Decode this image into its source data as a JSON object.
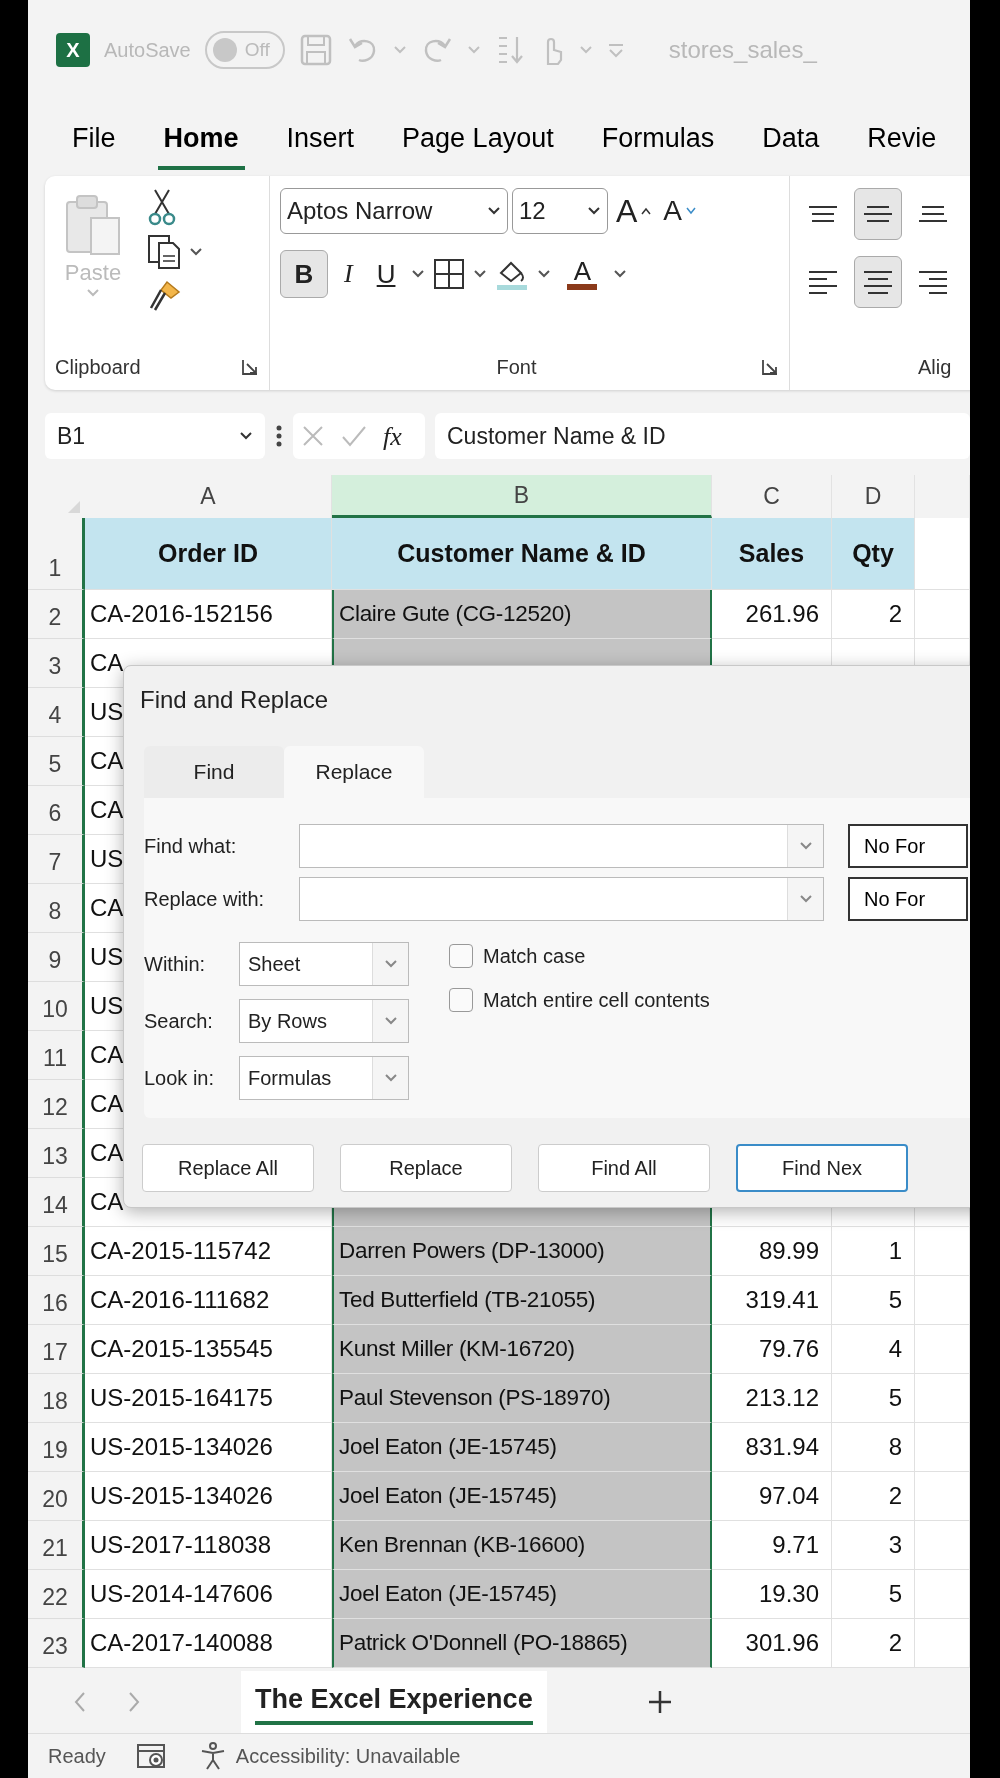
{
  "title_bar": {
    "logo_letter": "X",
    "autosave_label": "AutoSave",
    "autosave": {
      "on": false,
      "label": "Off"
    },
    "file_name": "stores_sales_"
  },
  "ribbon_tabs": [
    {
      "label": "File",
      "selected": false
    },
    {
      "label": "Home",
      "selected": true
    },
    {
      "label": "Insert",
      "selected": false
    },
    {
      "label": "Page Layout",
      "selected": false
    },
    {
      "label": "Formulas",
      "selected": false
    },
    {
      "label": "Data",
      "selected": false
    },
    {
      "label": "Revie",
      "selected": false
    }
  ],
  "clipboard": {
    "paste_label": "Paste",
    "group_label": "Clipboard"
  },
  "font": {
    "name": "Aptos Narrow",
    "size": "12",
    "grow_label": "A",
    "shrink_label": "A",
    "bold_label": "B",
    "italic_label": "I",
    "underline_label": "U",
    "font_color_label": "A",
    "bold": true,
    "group_label": "Font"
  },
  "alignment": {
    "group_label": "Alig",
    "vertical": [
      {
        "kind": "top",
        "selected": false
      },
      {
        "kind": "middle",
        "selected": true
      },
      {
        "kind": "bottom",
        "selected": false
      }
    ],
    "horizontal": [
      {
        "kind": "left",
        "selected": false
      },
      {
        "kind": "center",
        "selected": true
      },
      {
        "kind": "right",
        "selected": false
      }
    ]
  },
  "formula_bar": {
    "name_box": "B1",
    "fx_label": "fx",
    "content": "Customer Name & ID"
  },
  "columns": [
    {
      "label": "A",
      "selected": false
    },
    {
      "label": "B",
      "selected": true
    },
    {
      "label": "C",
      "selected": false
    },
    {
      "label": "D",
      "selected": false
    }
  ],
  "header_row": {
    "number": "1",
    "cells": [
      "Order ID",
      "Customer Name & ID",
      "Sales",
      "Qty"
    ]
  },
  "rows": [
    {
      "number": "2",
      "cells": [
        "CA-2016-152156",
        "Claire Gute (CG-12520)",
        "261.96",
        "2"
      ]
    },
    {
      "number": "3",
      "cells": [
        "CA"
      ]
    },
    {
      "number": "4",
      "cells": [
        "US"
      ]
    },
    {
      "number": "5",
      "cells": [
        "CA"
      ]
    },
    {
      "number": "6",
      "cells": [
        "CA"
      ]
    },
    {
      "number": "7",
      "cells": [
        "US"
      ]
    },
    {
      "number": "8",
      "cells": [
        "CA"
      ]
    },
    {
      "number": "9",
      "cells": [
        "US"
      ]
    },
    {
      "number": "10",
      "cells": [
        "US"
      ]
    },
    {
      "number": "11",
      "cells": [
        "CA"
      ]
    },
    {
      "number": "12",
      "cells": [
        "CA"
      ]
    },
    {
      "number": "13",
      "cells": [
        "CA"
      ]
    },
    {
      "number": "14",
      "cells": [
        "CA"
      ]
    },
    {
      "number": "15",
      "cells": [
        "CA-2015-115742",
        "Darren Powers (DP-13000)",
        "89.99",
        "1"
      ]
    },
    {
      "number": "16",
      "cells": [
        "CA-2016-111682",
        "Ted Butterfield (TB-21055)",
        "319.41",
        "5"
      ]
    },
    {
      "number": "17",
      "cells": [
        "CA-2015-135545",
        "Kunst Miller (KM-16720)",
        "79.76",
        "4"
      ]
    },
    {
      "number": "18",
      "cells": [
        "US-2015-164175",
        "Paul Stevenson (PS-18970)",
        "213.12",
        "5"
      ]
    },
    {
      "number": "19",
      "cells": [
        "US-2015-134026",
        "Joel Eaton (JE-15745)",
        "831.94",
        "8"
      ]
    },
    {
      "number": "20",
      "cells": [
        "US-2015-134026",
        "Joel Eaton (JE-15745)",
        "97.04",
        "2"
      ]
    },
    {
      "number": "21",
      "cells": [
        "US-2017-118038",
        "Ken Brennan (KB-16600)",
        "9.71",
        "3"
      ]
    },
    {
      "number": "22",
      "cells": [
        "US-2014-147606",
        "Joel Eaton (JE-15745)",
        "19.30",
        "5"
      ]
    },
    {
      "number": "23",
      "cells": [
        "CA-2017-140088",
        "Patrick O'Donnell (PO-18865)",
        "301.96",
        "2"
      ]
    }
  ],
  "dialog": {
    "title": "Find and Replace",
    "tabs": [
      {
        "label": "Find",
        "selected": false
      },
      {
        "label": "Replace",
        "selected": true
      }
    ],
    "fields": [
      {
        "label": "Find what:",
        "format_button": "No For"
      },
      {
        "label": "Replace with:",
        "format_button": "No For"
      }
    ],
    "options": [
      {
        "label": "Within:",
        "value": "Sheet"
      },
      {
        "label": "Search:",
        "value": "By Rows"
      },
      {
        "label": "Look in:",
        "value": "Formulas"
      }
    ],
    "checkboxes": [
      {
        "label": "Match case",
        "checked": false
      },
      {
        "label": "Match entire cell contents",
        "checked": false
      }
    ],
    "buttons": [
      {
        "label": "Replace All",
        "default": false
      },
      {
        "label": "Replace",
        "default": false
      },
      {
        "label": "Find All",
        "default": false
      },
      {
        "label": "Find Nex",
        "default": true
      }
    ]
  },
  "sheet_tabs": [
    {
      "label": "The Excel Experience",
      "selected": true
    }
  ],
  "status_bar": {
    "ready": "Ready",
    "accessibility": "Accessibility: Unavailable"
  }
}
